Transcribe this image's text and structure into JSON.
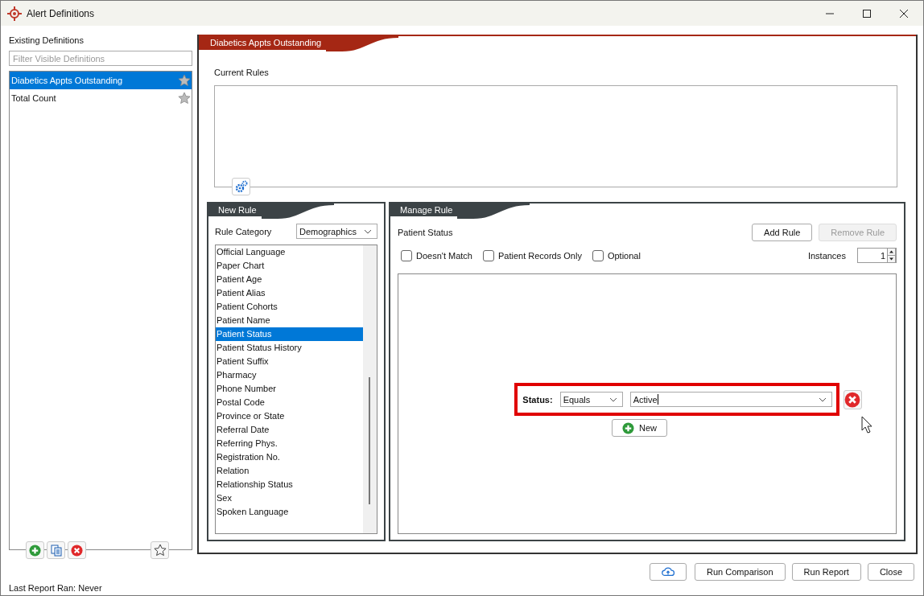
{
  "window": {
    "title": "Alert Definitions"
  },
  "definitions": {
    "label": "Existing Definitions",
    "placeholder": "Filter Visible Definitions",
    "items": [
      {
        "label": "Diabetics Appts Outstanding",
        "selected": true
      },
      {
        "label": "Total Count",
        "selected": false
      }
    ],
    "last_report": "Last Report Ran: Never"
  },
  "definition_panel": {
    "title": "Diabetics Appts Outstanding",
    "current_rules_label": "Current Rules"
  },
  "new_rule": {
    "title": "New Rule",
    "category_label": "Rule Category",
    "category": "Demographics",
    "items": [
      {
        "label": "Official Language",
        "selected": false
      },
      {
        "label": "Paper Chart",
        "selected": false
      },
      {
        "label": "Patient Age",
        "selected": false
      },
      {
        "label": "Patient Alias",
        "selected": false
      },
      {
        "label": "Patient Cohorts",
        "selected": false
      },
      {
        "label": "Patient Name",
        "selected": false
      },
      {
        "label": "Patient Status",
        "selected": true
      },
      {
        "label": "Patient Status History",
        "selected": false
      },
      {
        "label": "Patient Suffix",
        "selected": false
      },
      {
        "label": "Pharmacy",
        "selected": false
      },
      {
        "label": "Phone Number",
        "selected": false
      },
      {
        "label": "Postal Code",
        "selected": false
      },
      {
        "label": "Province or State",
        "selected": false
      },
      {
        "label": "Referral Date",
        "selected": false
      },
      {
        "label": "Referring Phys.",
        "selected": false
      },
      {
        "label": "Registration No.",
        "selected": false
      },
      {
        "label": "Relation",
        "selected": false
      },
      {
        "label": "Relationship Status",
        "selected": false
      },
      {
        "label": "Sex",
        "selected": false
      },
      {
        "label": "Spoken Language",
        "selected": false
      }
    ]
  },
  "manage_rule": {
    "title": "Manage Rule",
    "rule_name": "Patient Status",
    "buttons": [
      {
        "label": "Add Rule",
        "disabled": false
      },
      {
        "label": "Remove Rule",
        "disabled": true
      }
    ],
    "options": [
      {
        "label": "Doesn't Match",
        "checked": false
      },
      {
        "label": "Patient Records Only",
        "checked": false
      },
      {
        "label": "Optional",
        "checked": false
      }
    ],
    "instances_label": "Instances",
    "instances": "1",
    "condition": {
      "label": "Status:",
      "operator": "Equals",
      "value": "Active",
      "highlighted": true
    },
    "new_button": "New"
  },
  "footer_buttons": [
    "Run Comparison",
    "Run Report",
    "Close"
  ]
}
